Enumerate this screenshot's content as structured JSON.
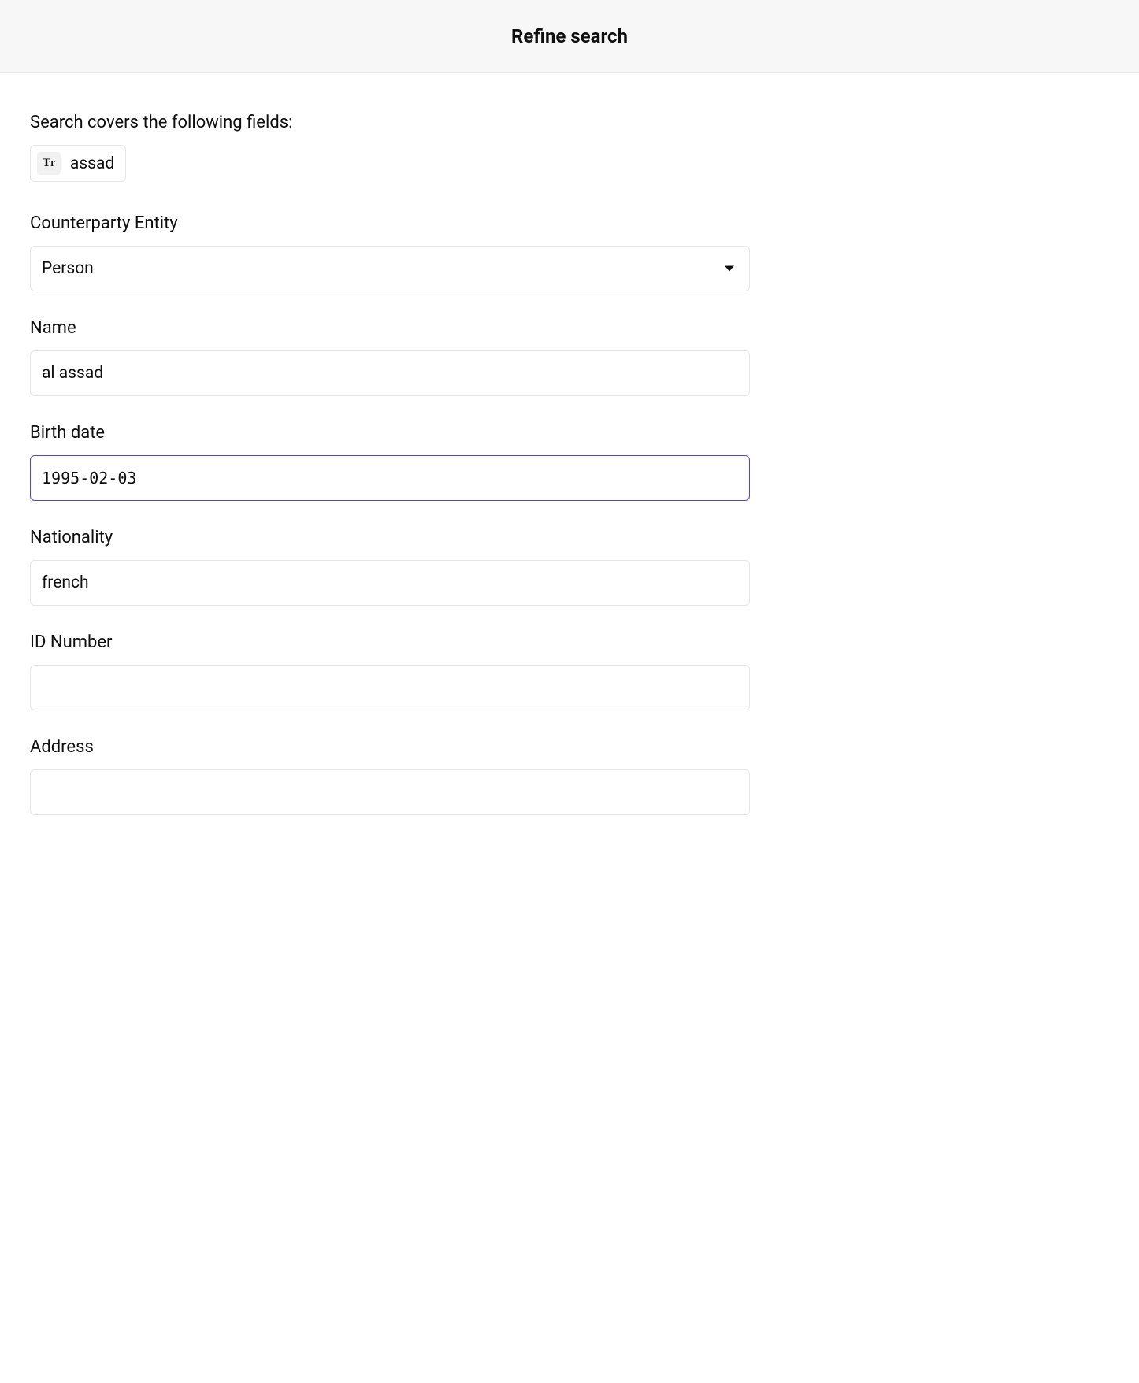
{
  "header": {
    "title": "Refine search"
  },
  "search_fields": {
    "label": "Search covers the following fields:",
    "tag": "assad",
    "icon_name": "text-type-icon"
  },
  "form": {
    "counterparty_entity": {
      "label": "Counterparty Entity",
      "value": "Person"
    },
    "name": {
      "label": "Name",
      "value": "al assad"
    },
    "birth_date": {
      "label": "Birth date",
      "value": "1995-02-03"
    },
    "nationality": {
      "label": "Nationality",
      "value": "french"
    },
    "id_number": {
      "label": "ID Number",
      "value": ""
    },
    "address": {
      "label": "Address",
      "value": ""
    }
  }
}
